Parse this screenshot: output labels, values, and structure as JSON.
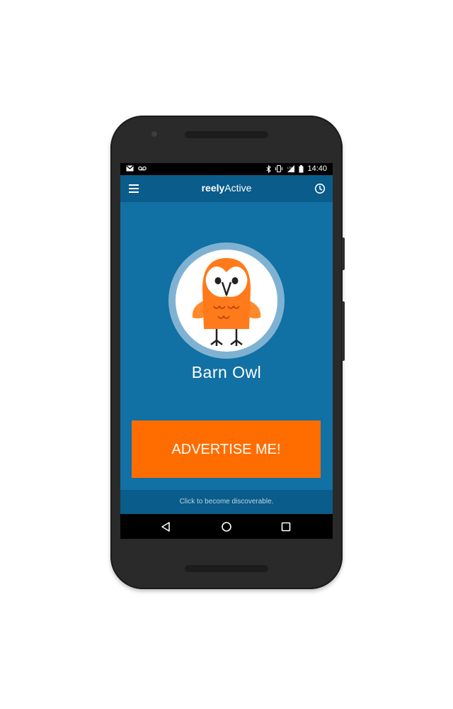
{
  "status_bar": {
    "time": "14:40",
    "icons": [
      "gmail-icon",
      "voicemail-icon",
      "bluetooth-icon",
      "vibrate-icon",
      "lte-signal-icon",
      "battery-icon"
    ]
  },
  "toolbar": {
    "title_bold": "reely",
    "title_rest": "Active",
    "menu_icon": "hamburger-menu-icon",
    "history_icon": "clock-icon"
  },
  "profile": {
    "name": "Barn Owl",
    "avatar": "barn-owl-illustration"
  },
  "actions": {
    "advertise_label": "ADVERTISE ME!"
  },
  "footer": {
    "hint": "Click to become discoverable."
  },
  "navigation": {
    "back": "back-triangle-icon",
    "home": "home-circle-icon",
    "recents": "recents-square-icon"
  },
  "colors": {
    "toolbar": "#0a5c8b",
    "content": "#1170a4",
    "accent": "#ff6d00",
    "avatar_ring": "#7fb2d2"
  }
}
